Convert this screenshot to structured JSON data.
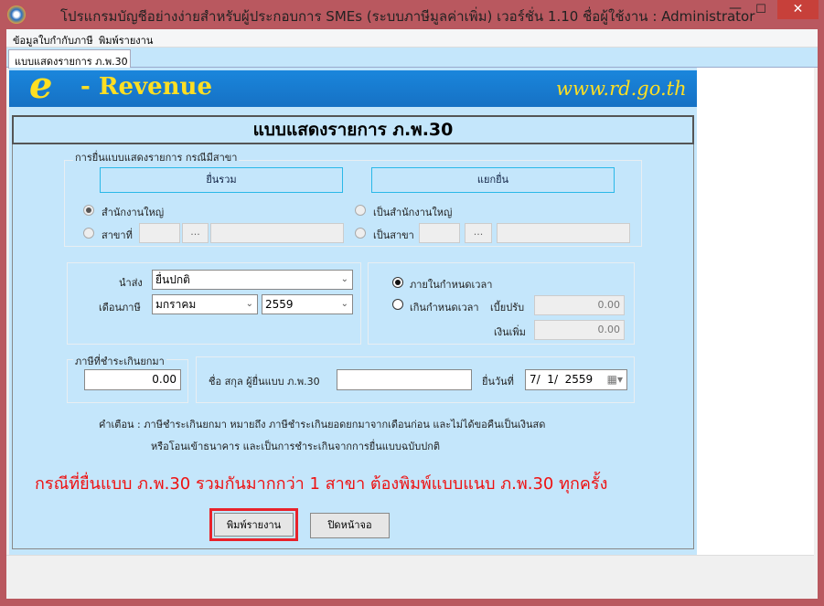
{
  "window": {
    "title": "โปรแกรมบัญชีอย่างง่ายสำหรับผู้ประกอบการ SMEs   (ระบบภาษีมูลค่าเพิ่ม)  เวอร์ชั่น 1.10     ชื่อผู้ใช้งาน : Administrator",
    "minimize": "—",
    "maximize": "☐",
    "close": "✕"
  },
  "menu": [
    "ข้อมูลใบกำกับภาษี",
    "พิมพ์รายงาน"
  ],
  "tab": "แบบแสดงรายการ ภ.พ.30",
  "banner": {
    "logo_e": "e",
    "logo_text": "- Revenue",
    "url": "www.rd.go.th"
  },
  "form": {
    "title": "แบบแสดงรายการ ภ.พ.30",
    "branch_group_label": "การยื่นแบบแสดงรายการ กรณีมีสาขา",
    "combined_button": "ยื่นรวม",
    "separate_button": "แยกยื่น",
    "left_radios": [
      "สำนักงานใหญ่",
      "สาขาที่"
    ],
    "right_radios": [
      "เป็นสำนักงานใหญ่",
      "เป็นสาขา"
    ],
    "ellipsis": "...",
    "submit_label": "นำส่ง",
    "submit_value": "ยื่นปกติ",
    "tax_month_label": "เดือนภาษี",
    "month_value": "มกราคม",
    "year_value": "2559",
    "deadline_radios": [
      "ภายในกำหนดเวลา",
      "เกินกำหนดเวลา"
    ],
    "penalty_label": "เบี้ยปรับ",
    "penalty_value": "0.00",
    "surcharge_label": "เงินเพิ่ม",
    "surcharge_value": "0.00",
    "carry_label": "ภาษีที่ชำระเกินยกมา",
    "carry_value": "0.00",
    "filer_label": "ชื่อ สกุล ผู้ยื่นแบบ ภ.พ.30",
    "filer_value": "",
    "file_date_label": "ยื่นวันที่",
    "file_date_value": "7/  1/  2559",
    "warning_line1": "คำเตือน : ภาษีชำระเกินยกมา หมายถึง ภาษีชำระเกินยอดยกมาจากเดือนก่อน และไม่ได้ขอคืนเป็นเงินสด",
    "warning_line2": "หรือโอนเข้าธนาคาร และเป็นการชำระเกินจากการยื่นแบบฉบับปกติ",
    "red_notice": "กรณีที่ยื่นแบบ ภ.พ.30 รวมกันมากกว่า 1 สาขา ต้องพิมพ์แบบแนบ ภ.พ.30 ทุกครั้ง",
    "print_button": "พิมพ์รายงาน",
    "close_button": "ปิดหน้าจอ"
  },
  "colors": {
    "titlebar": "#b9585f",
    "panel": "#c4e6fb",
    "banner": "#1a86dc",
    "logo": "#ffdf22",
    "notice": "#ee1111",
    "highlight": "#e8222a"
  }
}
